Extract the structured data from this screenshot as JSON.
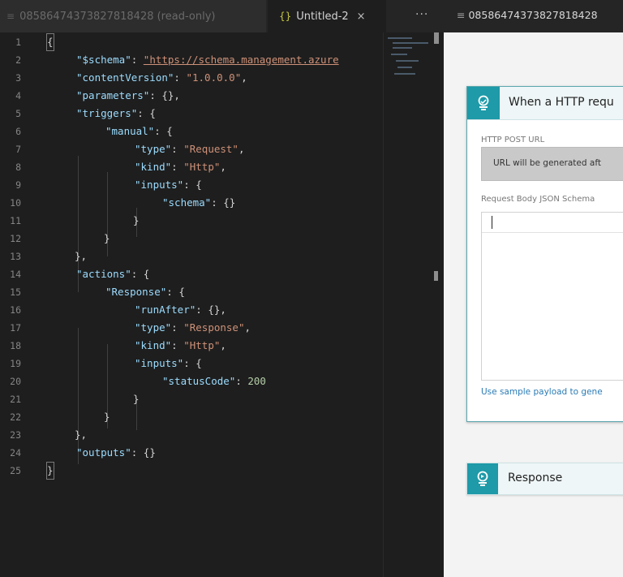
{
  "editor": {
    "tabs": [
      {
        "label": "08586474373827818428 (read-only)",
        "icon": "file-lines-icon"
      },
      {
        "label": "Untitled-2",
        "icon": "braces-icon",
        "close": "×"
      }
    ],
    "more": "···",
    "line_numbers": [
      "1",
      "2",
      "3",
      "4",
      "5",
      "6",
      "7",
      "8",
      "9",
      "10",
      "11",
      "12",
      "13",
      "14",
      "15",
      "16",
      "17",
      "18",
      "19",
      "20",
      "21",
      "22",
      "23",
      "24",
      "25"
    ],
    "code": {
      "l1": "{",
      "l2_key": "\"$schema\"",
      "l2_val": "\"https://schema.management.azure",
      "l3_key": "\"contentVersion\"",
      "l3_val": "\"1.0.0.0\"",
      "l4_key": "\"parameters\"",
      "l4_val": "{},",
      "l5_key": "\"triggers\"",
      "l5_val": "{",
      "l6_key": "\"manual\"",
      "l6_val": "{",
      "l7_key": "\"type\"",
      "l7_val": "\"Request\"",
      "l8_key": "\"kind\"",
      "l8_val": "\"Http\"",
      "l9_key": "\"inputs\"",
      "l9_val": "{",
      "l10_key": "\"schema\"",
      "l10_val": "{}",
      "l11": "}",
      "l12": "}",
      "l13": "},",
      "l14_key": "\"actions\"",
      "l14_val": "{",
      "l15_key": "\"Response\"",
      "l15_val": "{",
      "l16_key": "\"runAfter\"",
      "l16_val": "{},",
      "l17_key": "\"type\"",
      "l17_val": "\"Response\"",
      "l18_key": "\"kind\"",
      "l18_val": "\"Http\"",
      "l19_key": "\"inputs\"",
      "l19_val": "{",
      "l20_key": "\"statusCode\"",
      "l20_val": "200",
      "l21": "}",
      "l22": "}",
      "l23": "},",
      "l24_key": "\"outputs\"",
      "l24_val": "{}",
      "l25": "}"
    }
  },
  "designer": {
    "tab_label": "08586474373827818428",
    "tab_icon": "file-lines-icon",
    "trigger": {
      "icon": "http-request-icon",
      "title": "When a HTTP requ",
      "url_label": "HTTP POST URL",
      "url_placeholder": "URL will be generated aft",
      "schema_label": "Request Body JSON Schema",
      "sample_link": "Use sample payload to gene"
    },
    "response": {
      "icon": "http-response-icon",
      "title": "Response"
    }
  },
  "colors": {
    "accent_teal": "#1e9aa8",
    "editor_bg": "#1e1e1e",
    "json_key": "#9cdcfe",
    "json_string": "#ce9178",
    "json_number": "#b5cea8"
  }
}
